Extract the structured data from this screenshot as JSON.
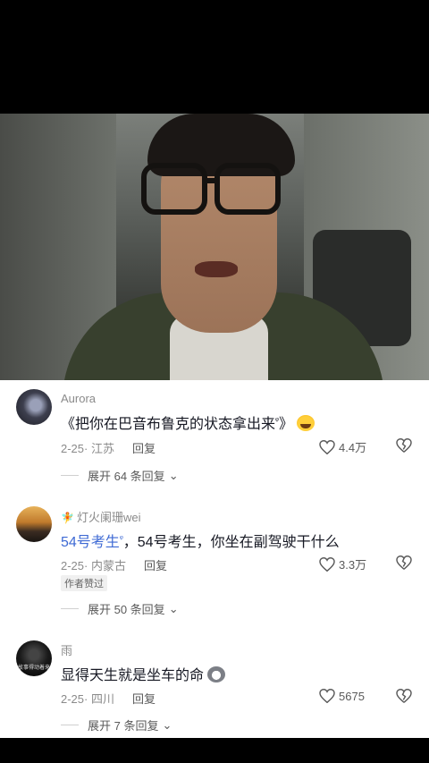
{
  "comments": [
    {
      "username": "Aurora",
      "text_prefix": "《把你在巴音布鲁克的状态拿出来",
      "text_sup": "ᵠ",
      "text_suffix": "》",
      "emoji": "laughing-crying-emoji",
      "date_location": "2-25· 江苏",
      "reply_label": "回复",
      "like_count": "4.4万",
      "expand_label": "展开 64 条回复",
      "expand_icon": "chevron-down-icon"
    },
    {
      "badge": "🧚",
      "username": "灯火阑珊wei",
      "text_link": "54号考生",
      "text_sup": "ᵠ",
      "text_rest": "，54号考生，你坐在副驾驶干什么",
      "date_location": "2-25· 内蒙古",
      "reply_label": "回复",
      "like_count": "3.3万",
      "author_liked": "作者赞过",
      "expand_label": "展开 50 条回复",
      "expand_icon": "chevron-down-icon"
    },
    {
      "username": "雨",
      "avatar_text": "故事得动着来",
      "text": "显得天生就是坐车的命",
      "emoji": "husky-emoji",
      "date_location": "2-25· 四川",
      "reply_label": "回复",
      "like_count": "5675",
      "expand_label": "展开 7 条回复",
      "expand_icon": "chevron-down-icon"
    }
  ],
  "colors": {
    "link": "#3e6ad4",
    "text": "#161823",
    "muted": "#8a8a8a"
  }
}
